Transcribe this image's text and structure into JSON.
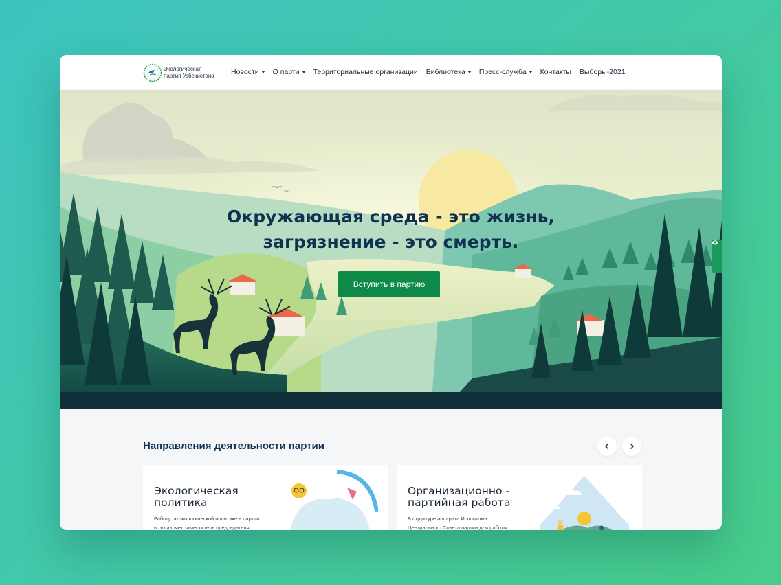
{
  "header": {
    "logo_line1": "Экологическая",
    "logo_line2": "партия Узбекистана",
    "nav": [
      {
        "label": "Новости",
        "dropdown": true
      },
      {
        "label": "О парти",
        "dropdown": true
      },
      {
        "label": "Территориальные организации",
        "dropdown": false
      },
      {
        "label": "Библиотека",
        "dropdown": true
      },
      {
        "label": "Пресс-служба",
        "dropdown": true
      },
      {
        "label": "Контакты",
        "dropdown": false
      },
      {
        "label": "Выборы-2021",
        "dropdown": false
      }
    ]
  },
  "hero": {
    "title_line1": "Окружающая среда - это жизнь,",
    "title_line2": "загрязнение - это смерть.",
    "cta_label": "Вступить в партию"
  },
  "accessibility": {
    "icons": [
      "speaker-icon",
      "eye-icon"
    ]
  },
  "directions": {
    "title": "Направления деятельности партии",
    "cards": [
      {
        "title_line1": "Экологическая",
        "title_line2": "политика",
        "desc_line1": "Работу по экологической политике в партии",
        "desc_line2": "возглавляет заместитель председателя"
      },
      {
        "title_line1": "Организационно -",
        "title_line2": "партийная работа",
        "desc_line1": "В структуре аппарата Исполкома",
        "desc_line2": "Центрального Совета партии для работы"
      }
    ]
  },
  "colors": {
    "accent": "#0e8a48",
    "heading": "#0f3152",
    "background_from": "#3cc3c0",
    "background_to": "#48cc8a"
  }
}
